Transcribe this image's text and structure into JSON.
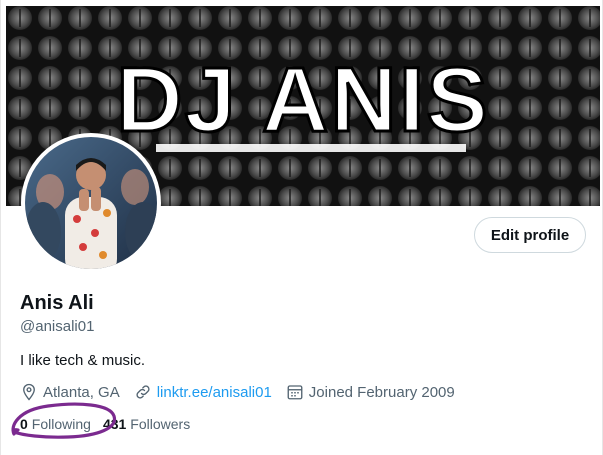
{
  "banner": {
    "text": "DJ ANIS"
  },
  "profile": {
    "name": "Anis Ali",
    "handle": "@anisali01",
    "bio": "I like tech & music.",
    "location": "Atlanta, GA",
    "link": "linktr.ee/anisali01",
    "joined": "Joined February 2009",
    "following_count": "0",
    "following_label": "Following",
    "followers_count": "431",
    "followers_label": "Followers"
  },
  "actions": {
    "edit_profile": "Edit profile"
  },
  "icons": {
    "location": "location-pin-icon",
    "link": "link-icon",
    "calendar": "calendar-icon"
  },
  "colors": {
    "link": "#1d9bf0",
    "annotation": "#7b2a8f"
  }
}
